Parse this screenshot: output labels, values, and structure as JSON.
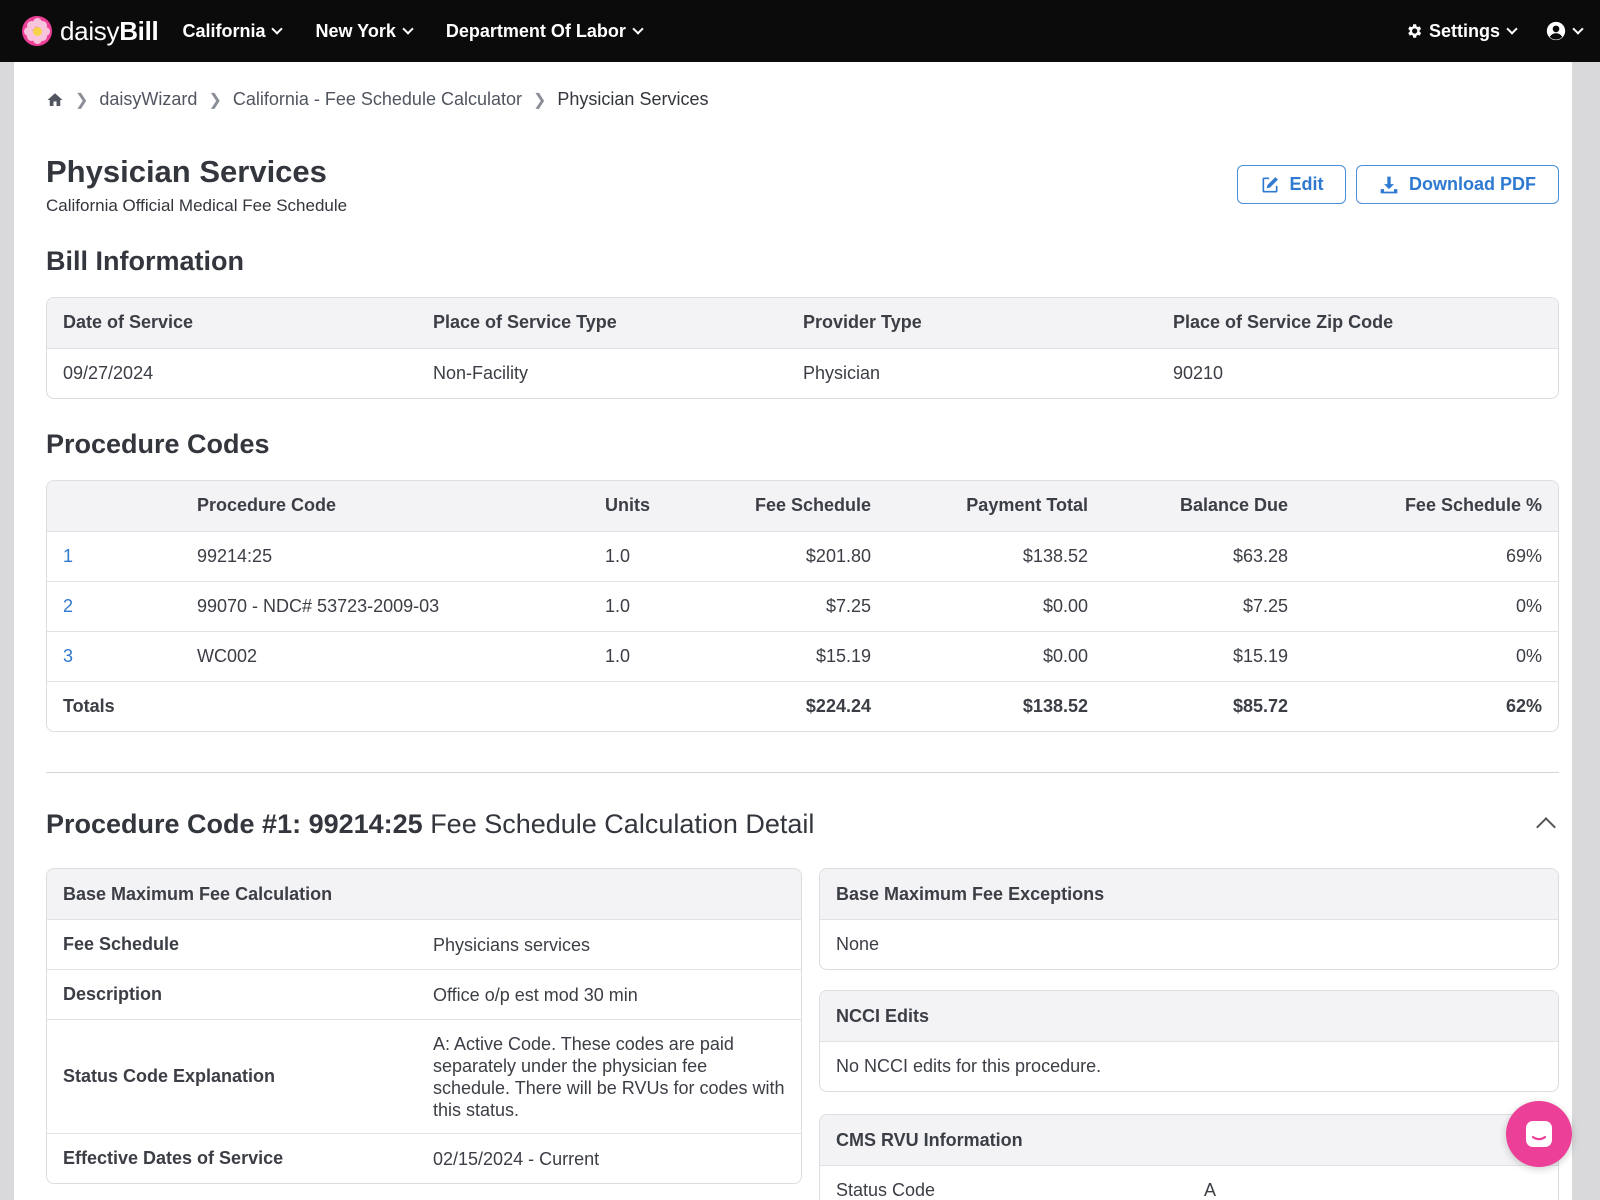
{
  "brand": {
    "prefix": "daisy",
    "suffix": "Bill"
  },
  "nav": {
    "items": [
      {
        "label": "California"
      },
      {
        "label": "New York"
      },
      {
        "label": "Department Of Labor"
      }
    ],
    "settings_label": "Settings"
  },
  "breadcrumb": [
    "daisyWizard",
    "California - Fee Schedule Calculator",
    "Physician Services"
  ],
  "page": {
    "title": "Physician Services",
    "subtitle": "California Official Medical Fee Schedule",
    "edit_label": "Edit",
    "pdf_label": "Download PDF"
  },
  "bill_info": {
    "heading": "Bill Information",
    "headers": [
      "Date of Service",
      "Place of Service Type",
      "Provider Type",
      "Place of Service Zip Code"
    ],
    "values": [
      "09/27/2024",
      "Non-Facility",
      "Physician",
      "90210"
    ]
  },
  "procedures": {
    "heading": "Procedure Codes",
    "headers": [
      "",
      "Procedure Code",
      "Units",
      "Fee Schedule",
      "Payment Total",
      "Balance Due",
      "Fee Schedule %"
    ],
    "rows": [
      [
        "1",
        "99214:25",
        "1.0",
        "$201.80",
        "$138.52",
        "$63.28",
        "69%"
      ],
      [
        "2",
        "99070 - NDC# 53723-2009-03",
        "1.0",
        "$7.25",
        "$0.00",
        "$7.25",
        "0%"
      ],
      [
        "3",
        "WC002",
        "1.0",
        "$15.19",
        "$0.00",
        "$15.19",
        "0%"
      ]
    ],
    "totals": [
      "Totals",
      "",
      "",
      "$224.24",
      "$138.52",
      "$85.72",
      "62%"
    ]
  },
  "detail": {
    "title_bold": "Procedure Code #1: 99214:25",
    "title_rest": " Fee Schedule Calculation Detail",
    "base_max": {
      "heading": "Base Maximum Fee Calculation",
      "rows": [
        {
          "k": "Fee Schedule",
          "v": "Physicians services"
        },
        {
          "k": "Description",
          "v": "Office o/p est mod 30 min"
        },
        {
          "k": "Status Code Explanation",
          "v": "A: Active Code. These codes are paid separately under the physician fee schedule. There will be RVUs for codes with this status."
        },
        {
          "k": "Effective Dates of Service",
          "v": "02/15/2024 - Current"
        }
      ]
    },
    "exceptions": {
      "heading": "Base Maximum Fee Exceptions",
      "value": "None"
    },
    "ncci": {
      "heading": "NCCI Edits",
      "value": "No NCCI edits for this procedure."
    },
    "rvu": {
      "heading": "CMS RVU Information",
      "row_k": "Status Code",
      "row_v": "A"
    }
  },
  "colors": {
    "accent": "#2f7ad0",
    "brand": "#ec3f97",
    "nav_bg": "#0b0b0c"
  },
  "icons": [
    "home-icon",
    "edit-icon",
    "download-icon",
    "gear-icon",
    "user-icon",
    "chevron-down-icon",
    "chevron-up-icon",
    "chat-icon"
  ]
}
